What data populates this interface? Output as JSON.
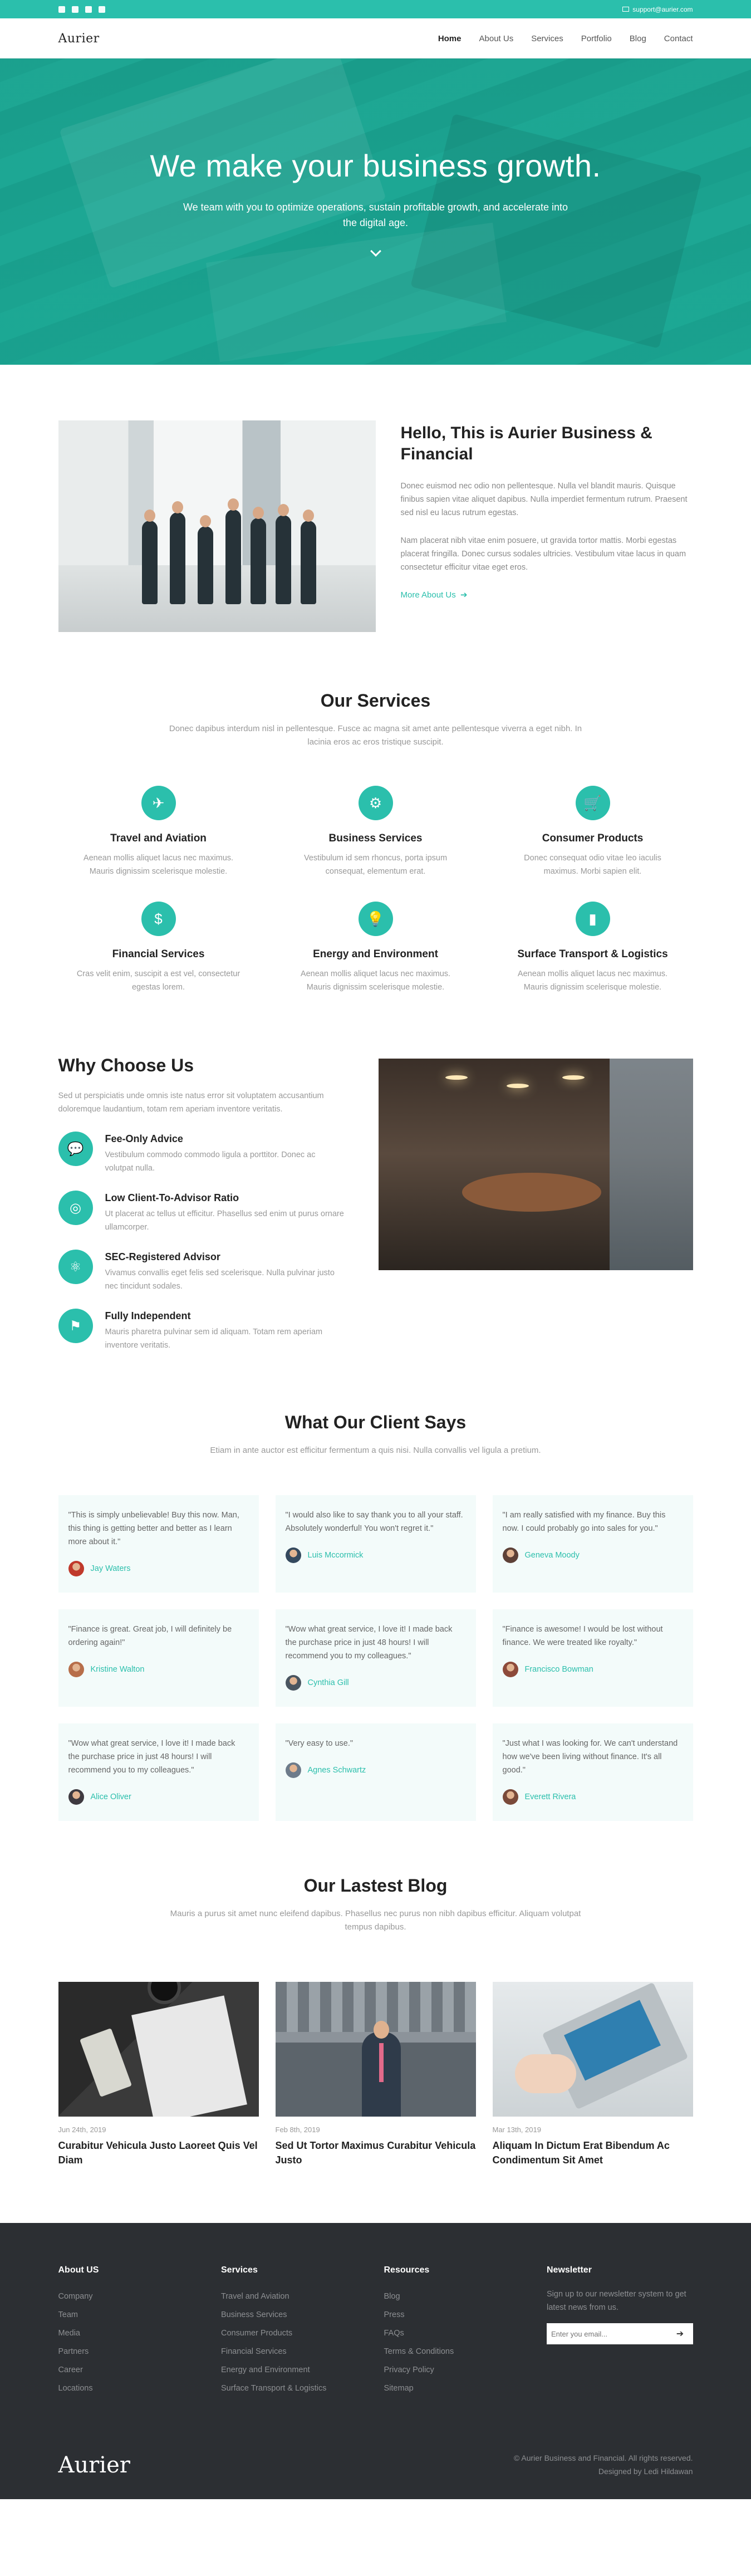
{
  "topbar": {
    "email": "support@aurier.com",
    "social": [
      "facebook-icon",
      "twitter-icon",
      "instagram-icon",
      "youtube-icon"
    ]
  },
  "nav": {
    "logo": "Aurier",
    "items": [
      "Home",
      "About Us",
      "Services",
      "Portfolio",
      "Blog",
      "Contact"
    ],
    "active": "Home"
  },
  "hero": {
    "title": "We make your business growth.",
    "subtitle": "We team with you to optimize operations, sustain profitable growth, and accelerate into the digital age."
  },
  "about": {
    "title": "Hello, This is Aurier Business & Financial",
    "p1": "Donec euismod nec odio non pellentesque. Nulla vel blandit mauris. Quisque finibus sapien vitae aliquet dapibus. Nulla imperdiet fermentum rutrum. Praesent sed nisl eu lacus rutrum egestas.",
    "p2": "Nam placerat nibh vitae enim posuere, ut gravida tortor mattis. Morbi egestas placerat fringilla. Donec cursus sodales ultricies. Vestibulum vitae lacus in quam consectetur efficitur vitae eget eros.",
    "more": "More About Us"
  },
  "services": {
    "title": "Our Services",
    "subtitle": "Donec dapibus interdum nisl in pellentesque. Fusce ac magna sit amet ante pellentesque viverra a eget nibh. In lacinia eros ac eros tristique suscipit.",
    "items": [
      {
        "icon": "plane-icon",
        "glyph": "✈",
        "title": "Travel and Aviation",
        "text": "Aenean mollis aliquet lacus nec maximus. Mauris dignissim scelerisque molestie."
      },
      {
        "icon": "briefcase-icon",
        "glyph": "⚙",
        "title": "Business Services",
        "text": "Vestibulum id sem rhoncus, porta ipsum consequat, elementum erat."
      },
      {
        "icon": "cart-icon",
        "glyph": "🛒",
        "title": "Consumer Products",
        "text": "Donec consequat odio vitae leo iaculis maximus. Morbi sapien elit."
      },
      {
        "icon": "dollar-icon",
        "glyph": "$",
        "title": "Financial Services",
        "text": "Cras velit enim, suscipit a est vel, consectetur egestas lorem."
      },
      {
        "icon": "lightbulb-icon",
        "glyph": "💡",
        "title": "Energy and Environment",
        "text": "Aenean mollis aliquet lacus nec maximus. Mauris dignissim scelerisque molestie."
      },
      {
        "icon": "bar-chart-icon",
        "glyph": "▮",
        "title": "Surface Transport & Logistics",
        "text": "Aenean mollis aliquet lacus nec maximus. Mauris dignissim scelerisque molestie."
      }
    ]
  },
  "why": {
    "title": "Why Choose Us",
    "subtitle": "Sed ut perspiciatis unde omnis iste natus error sit voluptatem accusantium doloremque laudantium, totam rem aperiam inventore veritatis.",
    "features": [
      {
        "icon": "chat-icon",
        "glyph": "💬",
        "title": "Fee-Only Advice",
        "text": "Vestibulum commodo commodo ligula a porttitor. Donec ac volutpat nulla."
      },
      {
        "icon": "target-icon",
        "glyph": "◎",
        "title": "Low Client-To-Advisor Ratio",
        "text": "Ut placerat ac tellus ut efficitur. Phasellus sed enim ut purus ornare ullamcorper."
      },
      {
        "icon": "atom-icon",
        "glyph": "⚛",
        "title": "SEC-Registered Advisor",
        "text": "Vivamus convallis eget felis sed scelerisque. Nulla pulvinar justo nec tincidunt sodales."
      },
      {
        "icon": "flag-icon",
        "glyph": "⚑",
        "title": "Fully Independent",
        "text": "Mauris pharetra pulvinar sem id aliquam. Totam rem aperiam inventore veritatis."
      }
    ]
  },
  "testimonials": {
    "title": "What Our Client Says",
    "subtitle": "Etiam in ante auctor est efficitur fermentum a quis nisi. Nulla convallis vel ligula a pretium.",
    "items": [
      {
        "quote": "\"This is simply unbelievable! Buy this now. Man, this thing is getting better and better as I learn more about it.\"",
        "name": "Jay Waters",
        "color": "#c0392b"
      },
      {
        "quote": "\"I would also like to say thank you to all your staff. Absolutely wonderful! You won't regret it.\"",
        "name": "Luis Mccormick",
        "color": "#34495e"
      },
      {
        "quote": "\"I am really satisfied with my finance. Buy this now. I could probably go into sales for you.\"",
        "name": "Geneva Moody",
        "color": "#5d4037"
      },
      {
        "quote": "\"Finance is great. Great job, I will definitely be ordering again!\"",
        "name": "Kristine Walton",
        "color": "#b76e4a"
      },
      {
        "quote": "\"Wow what great service, I love it! I made back the purchase price in just 48 hours! I will recommend you to my colleagues.\"",
        "name": "Cynthia Gill",
        "color": "#4a5560"
      },
      {
        "quote": "\"Finance is awesome! I would be lost without finance. We were treated like royalty.\"",
        "name": "Francisco Bowman",
        "color": "#8d4a3a"
      },
      {
        "quote": "\"Wow what great service, I love it! I made back the purchase price in just 48 hours! I will recommend you to my colleagues.\"",
        "name": "Alice Oliver",
        "color": "#3e3a40"
      },
      {
        "quote": "\"Very easy to use.\"",
        "name": "Agnes Schwartz",
        "color": "#6d7b8a"
      },
      {
        "quote": "\"Just what I was looking for. We can't understand how we've been living without finance. It's all good.\"",
        "name": "Everett Rivera",
        "color": "#7a4a3a"
      }
    ]
  },
  "blog": {
    "title": "Our Lastest Blog",
    "subtitle": "Mauris a purus sit amet nunc eleifend dapibus. Phasellus nec purus non nibh dapibus efficitur. Aliquam volutpat tempus dapibus.",
    "posts": [
      {
        "date": "Jun 24th, 2019",
        "title": "Curabitur Vehicula Justo Laoreet Quis Vel Diam"
      },
      {
        "date": "Feb 8th, 2019",
        "title": "Sed Ut Tortor Maximus Curabitur Vehicula Justo"
      },
      {
        "date": "Mar 13th, 2019",
        "title": "Aliquam In Dictum Erat Bibendum Ac Condimentum Sit Amet"
      }
    ]
  },
  "footer": {
    "cols": [
      {
        "title": "About US",
        "items": [
          "Company",
          "Team",
          "Media",
          "Partners",
          "Career",
          "Locations"
        ]
      },
      {
        "title": "Services",
        "items": [
          "Travel and Aviation",
          "Business Services",
          "Consumer Products",
          "Financial Services",
          "Energy and Environment",
          "Surface Transport & Logistics"
        ]
      },
      {
        "title": "Resources",
        "items": [
          "Blog",
          "Press",
          "FAQs",
          "Terms & Conditions",
          "Privacy Policy",
          "Sitemap"
        ]
      }
    ],
    "newsletter": {
      "title": "Newsletter",
      "text": "Sign up to our newsletter system to get latest news from us.",
      "placeholder": "Enter you email..."
    },
    "logo": "Aurier",
    "copyright": "© Aurier Business and Financial. All rights reserved.",
    "designer": "Designed by Ledi Hildawan"
  },
  "colors": {
    "accent": "#2bbfac",
    "footer": "#2c2f33"
  }
}
